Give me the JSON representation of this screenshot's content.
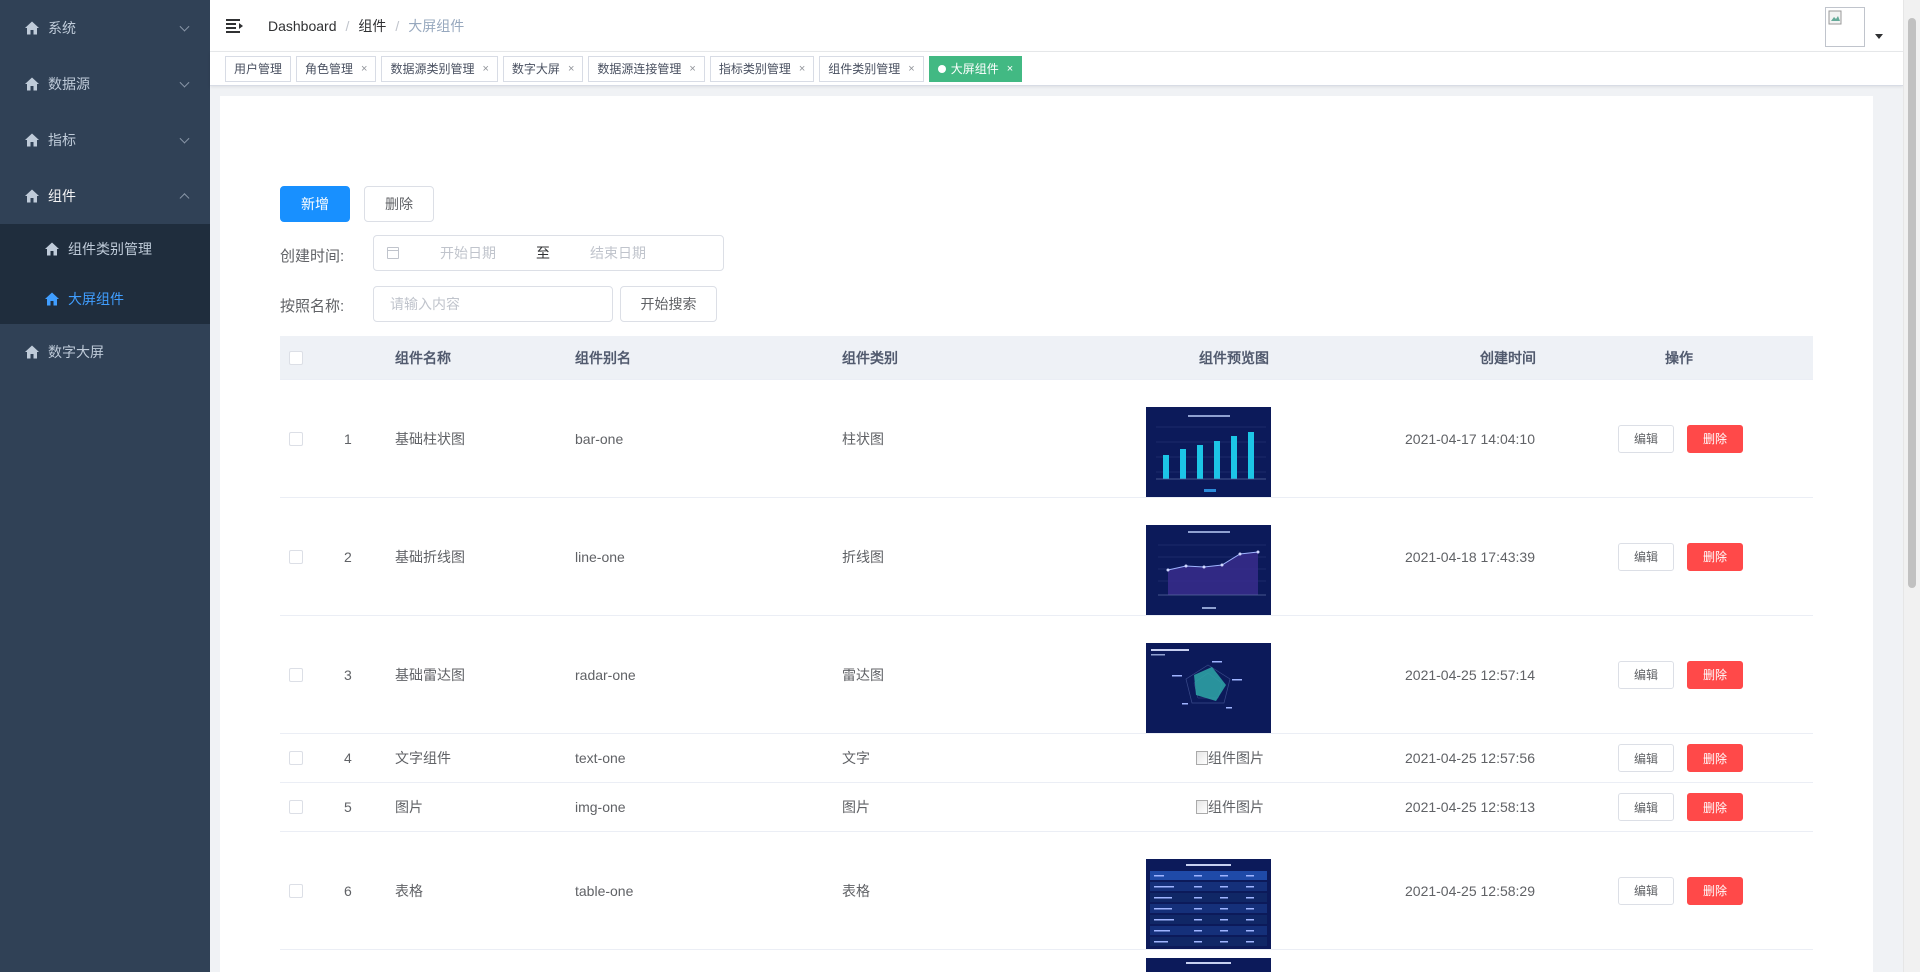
{
  "sidebar": {
    "menus": [
      {
        "label": "系统",
        "expanded": false
      },
      {
        "label": "数据源",
        "expanded": false
      },
      {
        "label": "指标",
        "expanded": false
      },
      {
        "label": "组件",
        "expanded": true
      },
      {
        "label": "数字大屏",
        "expanded": false
      }
    ],
    "submenu": [
      {
        "label": "组件类别管理",
        "active": false
      },
      {
        "label": "大屏组件",
        "active": true
      }
    ]
  },
  "navbar": {
    "breadcrumb": [
      "Dashboard",
      "组件",
      "大屏组件"
    ]
  },
  "tags": [
    {
      "label": "用户管理",
      "closable": false,
      "active": false
    },
    {
      "label": "角色管理",
      "closable": true,
      "active": false
    },
    {
      "label": "数据源类别管理",
      "closable": true,
      "active": false
    },
    {
      "label": "数字大屏",
      "closable": true,
      "active": false
    },
    {
      "label": "数据源连接管理",
      "closable": true,
      "active": false
    },
    {
      "label": "指标类别管理",
      "closable": true,
      "active": false
    },
    {
      "label": "组件类别管理",
      "closable": true,
      "active": false
    },
    {
      "label": "大屏组件",
      "closable": true,
      "active": true
    }
  ],
  "toolbar": {
    "add_label": "新增",
    "delete_label": "删除"
  },
  "filters": {
    "created_label": "创建时间:",
    "start_placeholder": "开始日期",
    "range_separator": "至",
    "end_placeholder": "结束日期",
    "name_label": "按照名称:",
    "name_placeholder": "请输入内容",
    "search_label": "开始搜索"
  },
  "table": {
    "headers": {
      "name": "组件名称",
      "alias": "组件别名",
      "type": "组件类别",
      "preview": "组件预览图",
      "time": "创建时间",
      "ops": "操作"
    },
    "edit_label": "编辑",
    "delete_label": "删除",
    "broken_image_alt": "组件图片",
    "rows": [
      {
        "index": "1",
        "name": "基础柱状图",
        "alias": "bar-one",
        "type": "柱状图",
        "preview": "bar",
        "time": "2021-04-17 14:04:10"
      },
      {
        "index": "2",
        "name": "基础折线图",
        "alias": "line-one",
        "type": "折线图",
        "preview": "line",
        "time": "2021-04-18 17:43:39"
      },
      {
        "index": "3",
        "name": "基础雷达图",
        "alias": "radar-one",
        "type": "雷达图",
        "preview": "radar",
        "time": "2021-04-25 12:57:14"
      },
      {
        "index": "4",
        "name": "文字组件",
        "alias": "text-one",
        "type": "文字",
        "preview": "broken",
        "time": "2021-04-25 12:57:56"
      },
      {
        "index": "5",
        "name": "图片",
        "alias": "img-one",
        "type": "图片",
        "preview": "broken",
        "time": "2021-04-25 12:58:13"
      },
      {
        "index": "6",
        "name": "表格",
        "alias": "table-one",
        "type": "表格",
        "preview": "table",
        "time": "2021-04-25 12:58:29"
      }
    ]
  },
  "colors": {
    "sidebar_bg": "#304156",
    "submenu_bg": "#1f2d3d",
    "active_menu": "#409eff",
    "primary": "#1890ff",
    "danger": "#ff4949",
    "active_tag": "#42b983"
  }
}
